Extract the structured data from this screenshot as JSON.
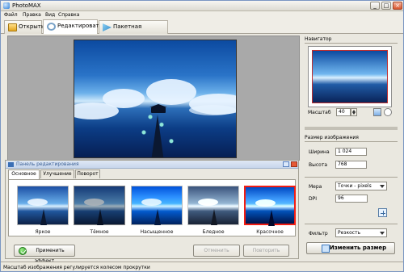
{
  "window": {
    "title": "PhotoMAX"
  },
  "menu": [
    "Файл",
    "Правка",
    "Вид",
    "Справка"
  ],
  "top_tabs": {
    "open": "Открыть",
    "edit": "Редактировать",
    "batch": "Пакетная обработка"
  },
  "editing_panel": {
    "title": "Панель редактирования",
    "tabs": [
      "Основное",
      "Улучшение",
      "Поворот"
    ],
    "effects": [
      {
        "label": "Яркое"
      },
      {
        "label": "Тёмное"
      },
      {
        "label": "Насыщенное"
      },
      {
        "label": "Бледное"
      },
      {
        "label": "Красочное"
      }
    ],
    "buttons": {
      "apply": "Применить эффект",
      "cancel": "Отменить",
      "repeat": "Повторить"
    }
  },
  "navigator": {
    "title": "Навигатор",
    "scale_label": "Масштаб",
    "scale_value": "40"
  },
  "resize": {
    "title": "Размер изображения",
    "width_label": "Ширина",
    "width_value": "1 024",
    "height_label": "Высота",
    "height_value": "768",
    "measure_label": "Мера",
    "measure_value": "Точки - pixels",
    "dpi_label": "DPI",
    "dpi_value": "96",
    "filter_label": "Фильтр",
    "filter_value": "Резкость",
    "button": "Изменить размер"
  },
  "status": {
    "text": "Масштаб изображения регулируется колесом прокрутки"
  }
}
